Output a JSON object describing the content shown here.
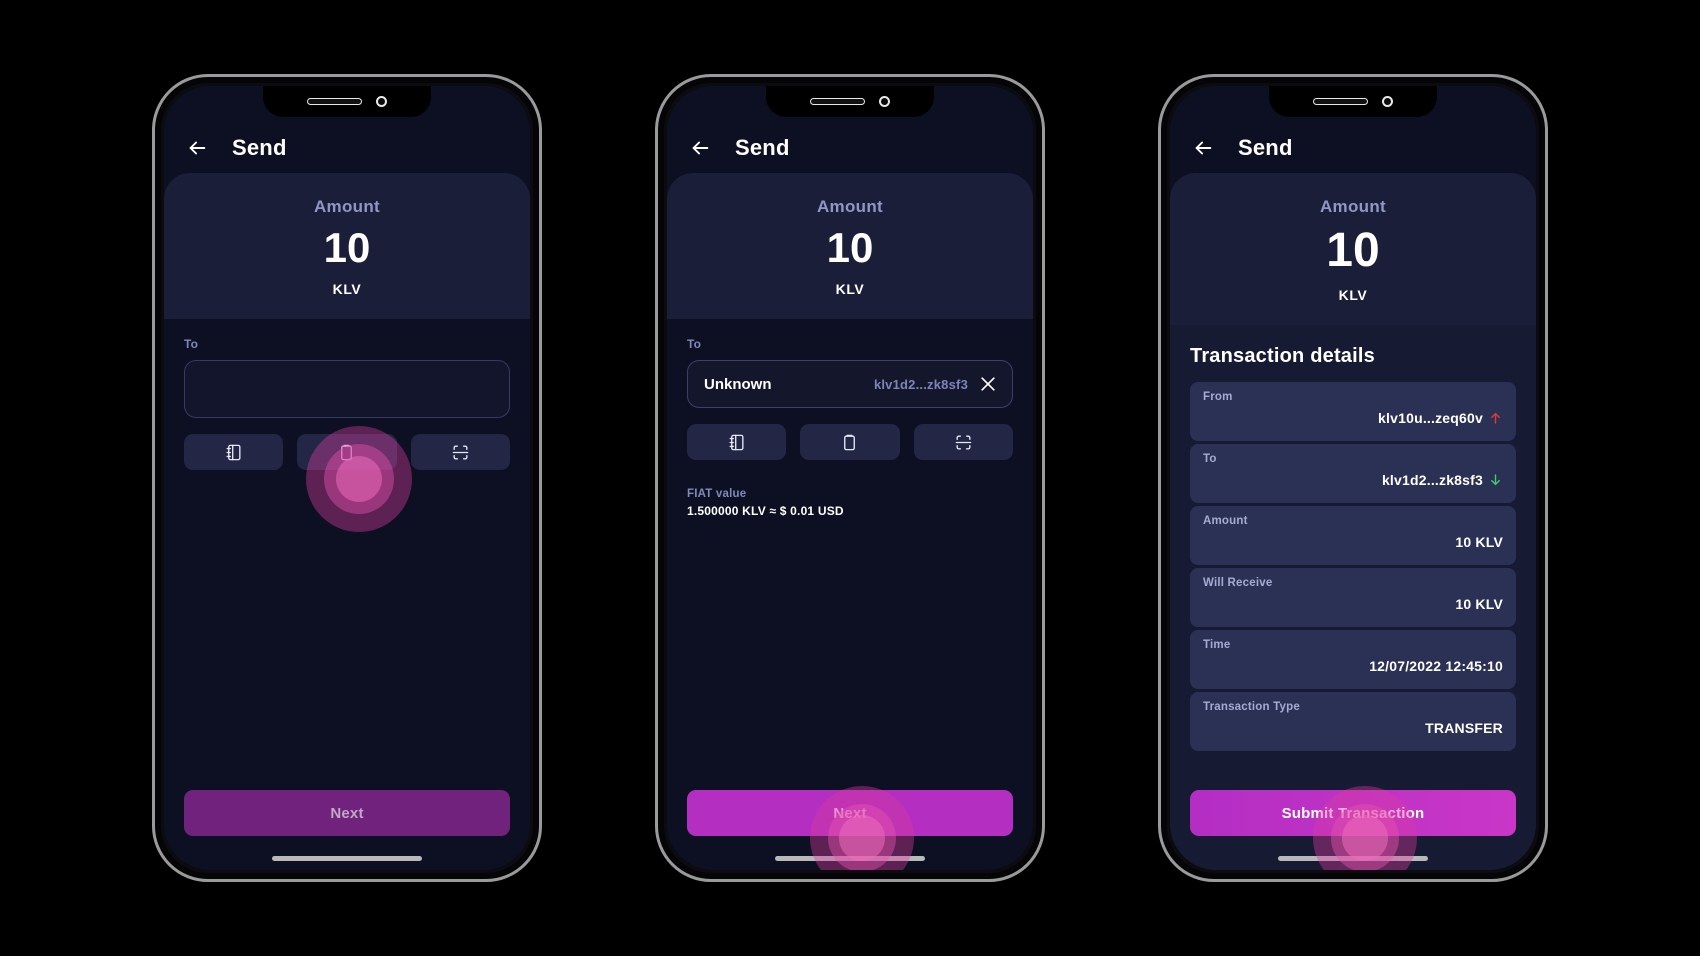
{
  "app": {
    "title": "Send",
    "back_icon": "arrow-left-icon"
  },
  "amount": {
    "label": "Amount",
    "value": "10",
    "unit": "KLV"
  },
  "screen1": {
    "to_label": "To",
    "to_value": "",
    "to_placeholder": "",
    "actions": [
      {
        "name": "address-book-icon",
        "label": "Contacts"
      },
      {
        "name": "clipboard-icon",
        "label": "Paste"
      },
      {
        "name": "qr-scan-icon",
        "label": "Scan QR"
      }
    ],
    "cta_label": "Next",
    "cta_state": "disabled",
    "tap_target": "clipboard-button"
  },
  "screen2": {
    "to_label": "To",
    "recipient_name": "Unknown",
    "recipient_address": "klv1d2...zk8sf3",
    "clear_icon": "close-icon",
    "actions": [
      {
        "name": "address-book-icon",
        "label": "Contacts"
      },
      {
        "name": "clipboard-icon",
        "label": "Paste"
      },
      {
        "name": "qr-scan-icon",
        "label": "Scan QR"
      }
    ],
    "fiat_label": "FIAT value",
    "fiat_value": "1.500000 KLV ≈ $ 0.01 USD",
    "cta_label": "Next",
    "cta_state": "active",
    "tap_target": "next-button"
  },
  "screen3": {
    "details_title": "Transaction details",
    "rows": [
      {
        "key": "From",
        "value": "klv10u...zeq60v",
        "icon": "arrow-up-icon",
        "icon_color": "#e53935"
      },
      {
        "key": "To",
        "value": "klv1d2...zk8sf3",
        "icon": "arrow-down-icon",
        "icon_color": "#3dd16a"
      },
      {
        "key": "Amount",
        "value": "10 KLV",
        "icon": "",
        "icon_color": ""
      },
      {
        "key": "Will Receive",
        "value": "10 KLV",
        "icon": "",
        "icon_color": ""
      },
      {
        "key": "Time",
        "value": "12/07/2022 12:45:10",
        "icon": "",
        "icon_color": ""
      },
      {
        "key": "Transaction Type",
        "value": "TRANSFER",
        "icon": "",
        "icon_color": ""
      }
    ],
    "cta_label": "Submit Transaction",
    "cta_state": "bright",
    "tap_target": "submit-transaction-button"
  },
  "colors": {
    "background": "#000000",
    "screen_bg": "#0d1022",
    "card_bg": "#1b1e38",
    "row_bg": "#2b3055",
    "accent": "#b52ec2",
    "accent_disabled": "#70227c",
    "muted_text": "#8089bb",
    "positive": "#3dd16a",
    "negative": "#e53935"
  }
}
